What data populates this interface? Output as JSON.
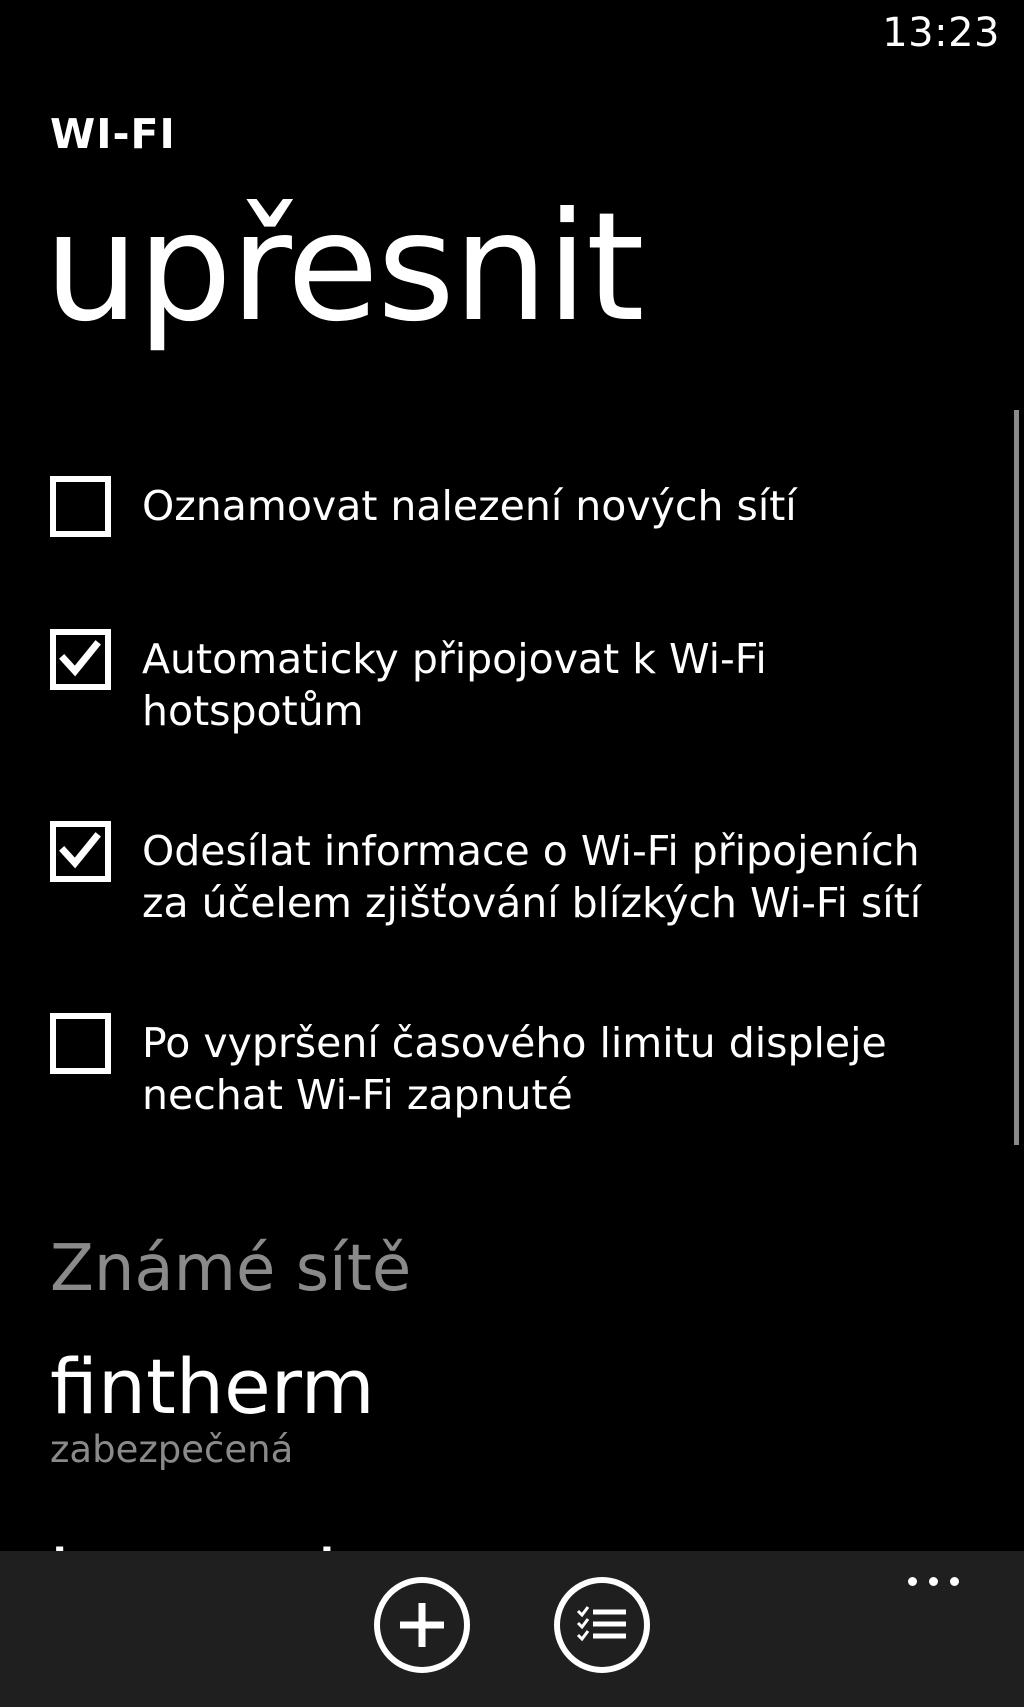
{
  "status_bar": {
    "time": "13:23"
  },
  "header": {
    "app_title": "WI-FI",
    "page_title": "upřesnit"
  },
  "options": [
    {
      "label": "Oznamovat nalezení nových sítí",
      "checked": false
    },
    {
      "label": "Automaticky připojovat k Wi-Fi hotspotům",
      "checked": true
    },
    {
      "label": "Odesílat informace o Wi-Fi připojeních za účelem zjišťování blízkých Wi-Fi sítí",
      "checked": true
    },
    {
      "label": "Po vypršení časového limitu displeje nechat Wi-Fi zapnuté",
      "checked": false
    }
  ],
  "known_networks": {
    "title": "Známé sítě",
    "items": [
      {
        "name": "fintherm",
        "status": "zabezpečená"
      }
    ]
  },
  "app_bar": {
    "buttons": [
      {
        "icon": "add-icon"
      },
      {
        "icon": "select-list-icon"
      }
    ],
    "more_icon": "ellipsis-icon"
  },
  "colors": {
    "background": "#000000",
    "foreground": "#ffffff",
    "subtle_text": "#8a8a8a",
    "app_bar": "#1f1f1f"
  }
}
